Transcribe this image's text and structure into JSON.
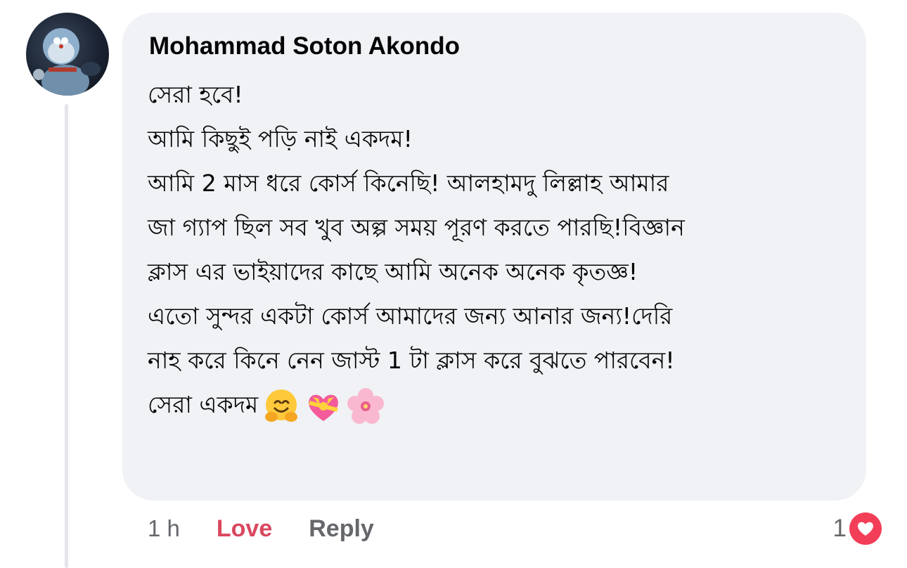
{
  "comment": {
    "author": "Mohammad Soton Akondo",
    "lines": [
      "সেরা হবে!",
      "আমি কিছুই পড়ি নাই একদম!",
      "আমি 2 মাস ধরে কোর্স কিনেছি! আলহামদু লিল্লাহ আমার",
      "জা গ্যাপ ছিল সব খুব অল্প সময় পূরণ করতে পারছি!বিজ্ঞান",
      "ক্লাস এর ভাইয়াদের কাছে  আমি  অনেক অনেক কৃতজ্ঞ!",
      "এতো সুন্দর একটা কোর্স আমাদের জন্য আনার জন্য!দেরি",
      "নাহ করে কিনে নেন জাস্ট 1 টা ক্লাস করে বুঝতে পারবেন!",
      "সেরা একদম"
    ],
    "emojis": [
      "hugging-face-emoji",
      "heart-with-ribbon-emoji",
      "cherry-blossom-emoji"
    ]
  },
  "actions": {
    "time": "1 h",
    "love_label": "Love",
    "reply_label": "Reply"
  },
  "reaction": {
    "count": "1",
    "icon": "heart-icon",
    "color": "#f33e58"
  },
  "colors": {
    "bubble": "#f0f2f5",
    "love": "#d9485f",
    "muted": "#65676b"
  }
}
